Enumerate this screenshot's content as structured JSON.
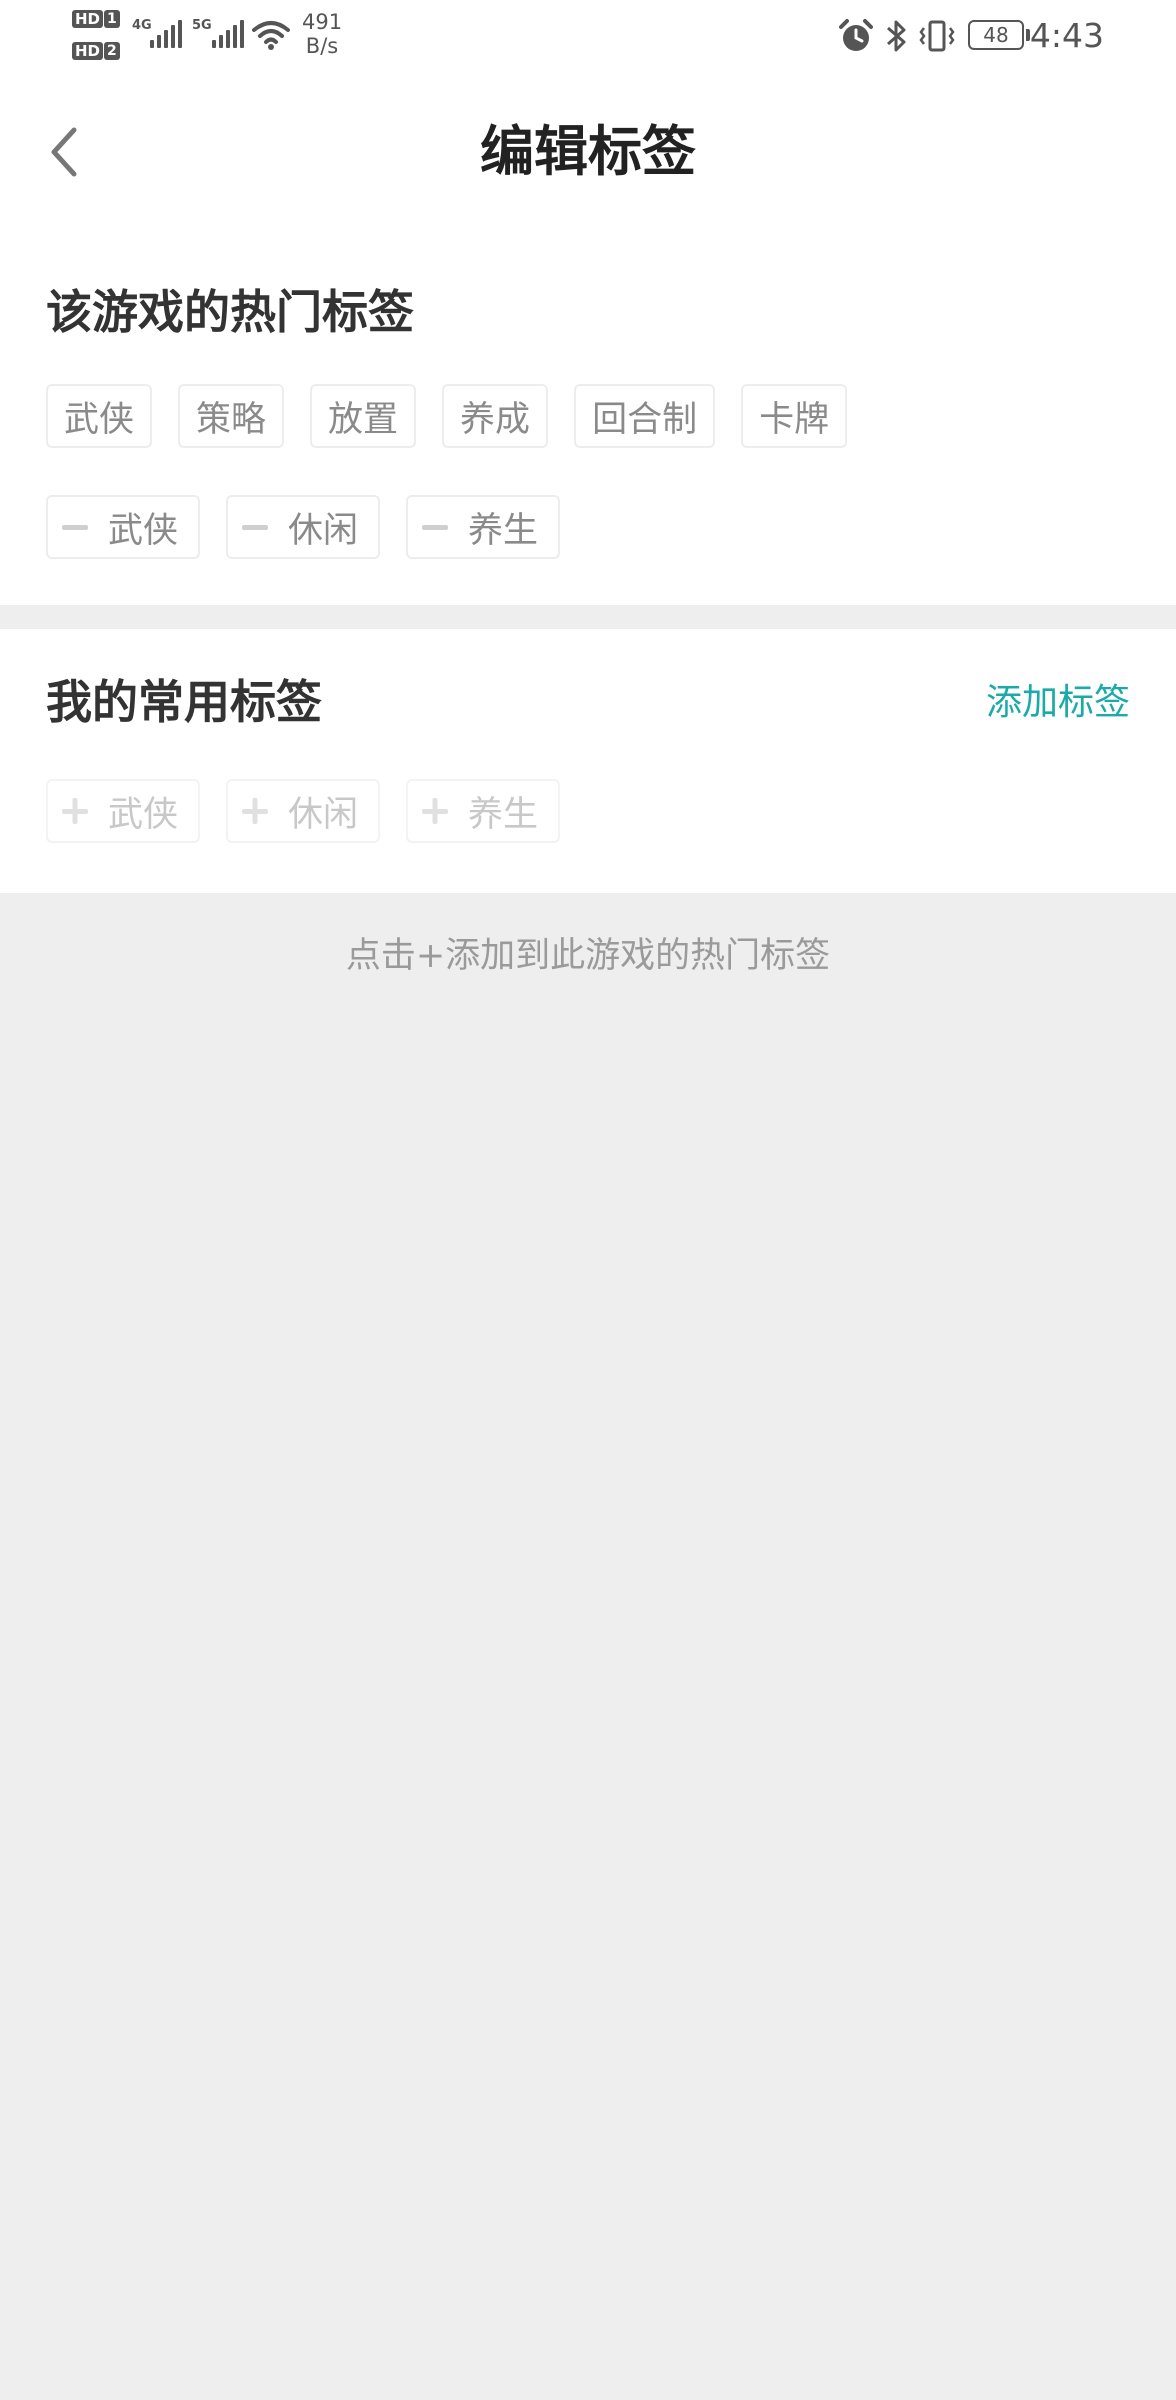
{
  "status_bar": {
    "hd1": "HD",
    "hd1_num": "1",
    "hd2": "HD",
    "hd2_num": "2",
    "net1": "4G",
    "net2": "5G",
    "speed_value": "491",
    "speed_unit": "B/s",
    "battery": "48",
    "time": "4:43",
    "icons": [
      "signal-icon",
      "wifi-icon",
      "alarm-icon",
      "bluetooth-icon",
      "vibrate-icon",
      "battery-icon"
    ]
  },
  "header": {
    "title": "编辑标签",
    "back_icon": "chevron-left-icon"
  },
  "hot_section": {
    "title": "该游戏的热门标签",
    "suggested_tags": [
      "武侠",
      "策略",
      "放置",
      "养成",
      "回合制",
      "卡牌"
    ],
    "selected_tags": [
      "武侠",
      "休闲",
      "养生"
    ],
    "remove_icon": "minus-icon"
  },
  "mine_section": {
    "title": "我的常用标签",
    "add_link": "添加标签",
    "tags": [
      "武侠",
      "休闲",
      "养生"
    ],
    "add_icon": "plus-icon"
  },
  "hint": "点击+添加到此游戏的热门标签",
  "colors": {
    "accent": "#1aaba8",
    "tag_text": "#8a8a8a",
    "tag_disabled_text": "#c8c8c8",
    "background": "#eeeeee"
  }
}
